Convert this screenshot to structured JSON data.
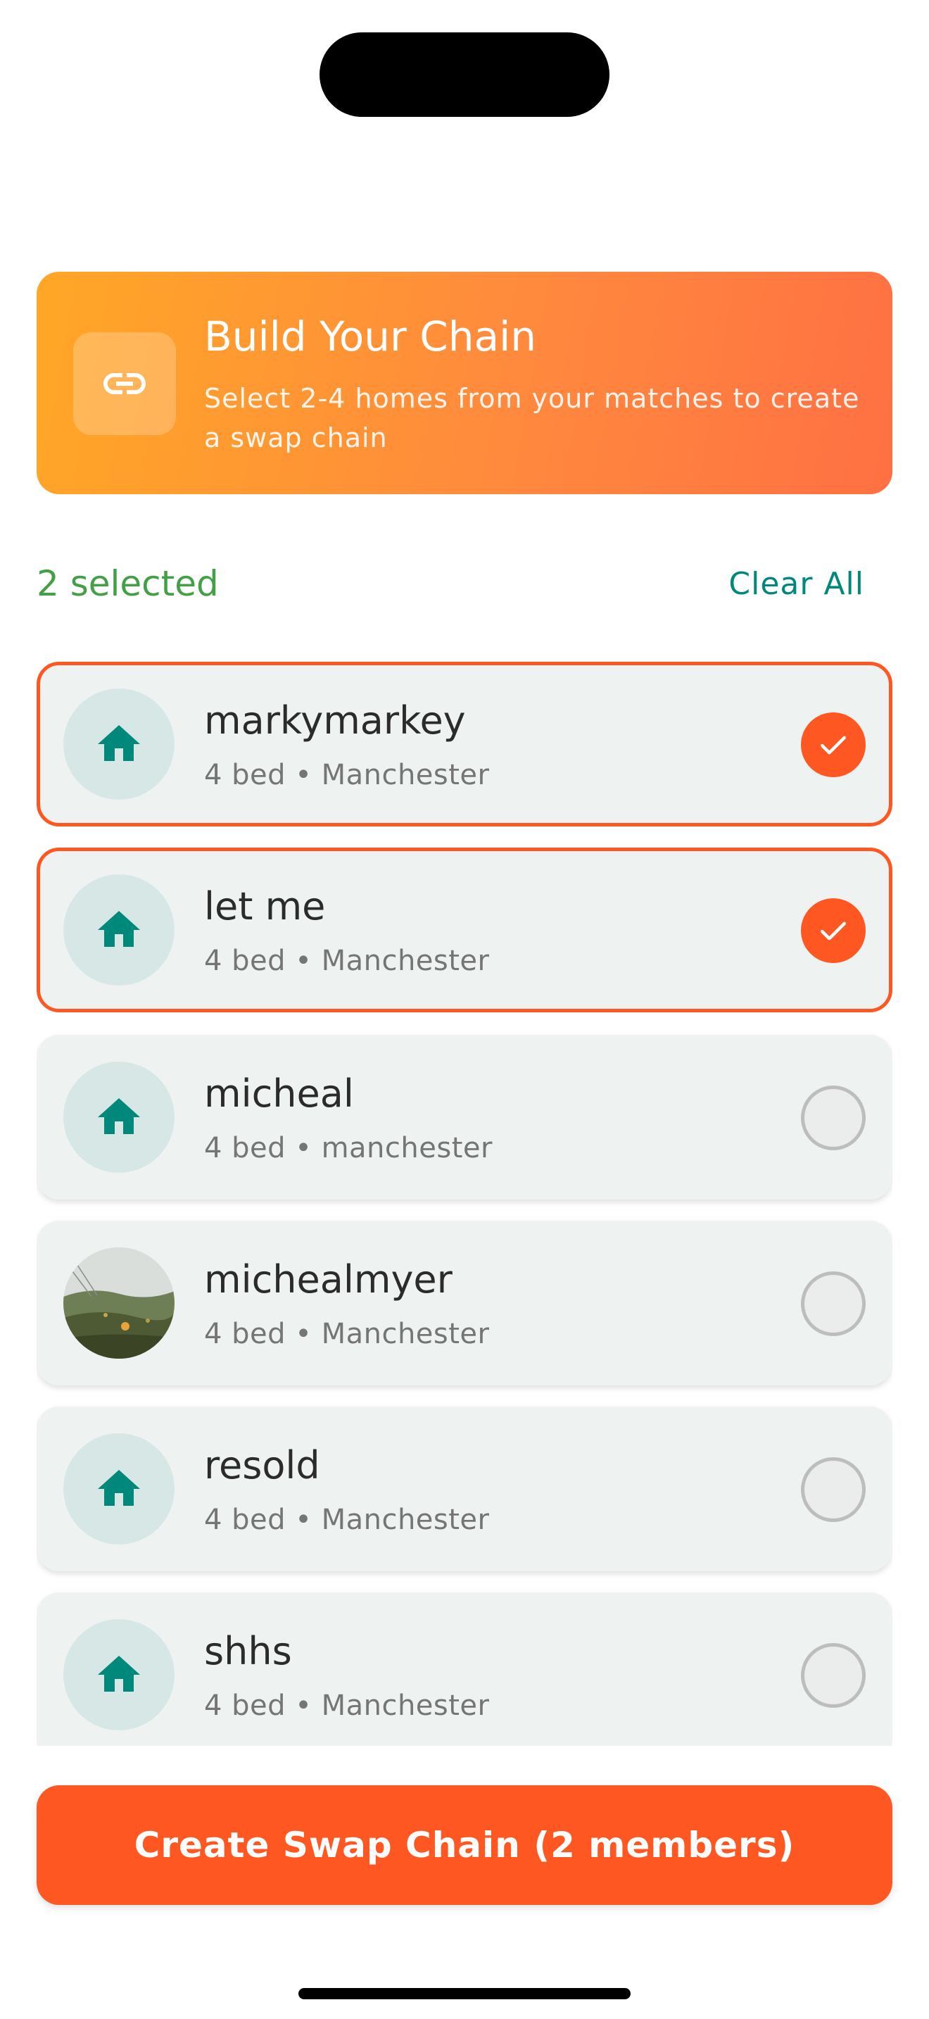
{
  "header": {
    "title": "Build Your Chain",
    "subtitle": "Select 2-4 homes from your matches to create a swap chain",
    "icon": "link-icon"
  },
  "selection": {
    "count_label": "2 selected",
    "clear_label": "Clear All"
  },
  "matches": [
    {
      "name": "markymarkey",
      "meta": "4 bed • Manchester",
      "selected": true,
      "avatar": "home-icon"
    },
    {
      "name": "let me",
      "meta": "4 bed • Manchester",
      "selected": true,
      "avatar": "home-icon"
    },
    {
      "name": "micheal",
      "meta": "4 bed • manchester",
      "selected": false,
      "avatar": "home-icon"
    },
    {
      "name": "michealmyer",
      "meta": "4 bed • Manchester",
      "selected": false,
      "avatar": "photo"
    },
    {
      "name": "resold",
      "meta": "4 bed • Manchester",
      "selected": false,
      "avatar": "home-icon"
    },
    {
      "name": "shhs",
      "meta": "4 bed • Manchester",
      "selected": false,
      "avatar": "home-icon"
    }
  ],
  "cta": {
    "label": "Create Swap Chain (2 members)"
  },
  "colors": {
    "accent": "#FF5722",
    "teal": "#00897B",
    "success": "#43A047",
    "gradient_start": "#FFA726",
    "gradient_end": "#FF7043"
  }
}
